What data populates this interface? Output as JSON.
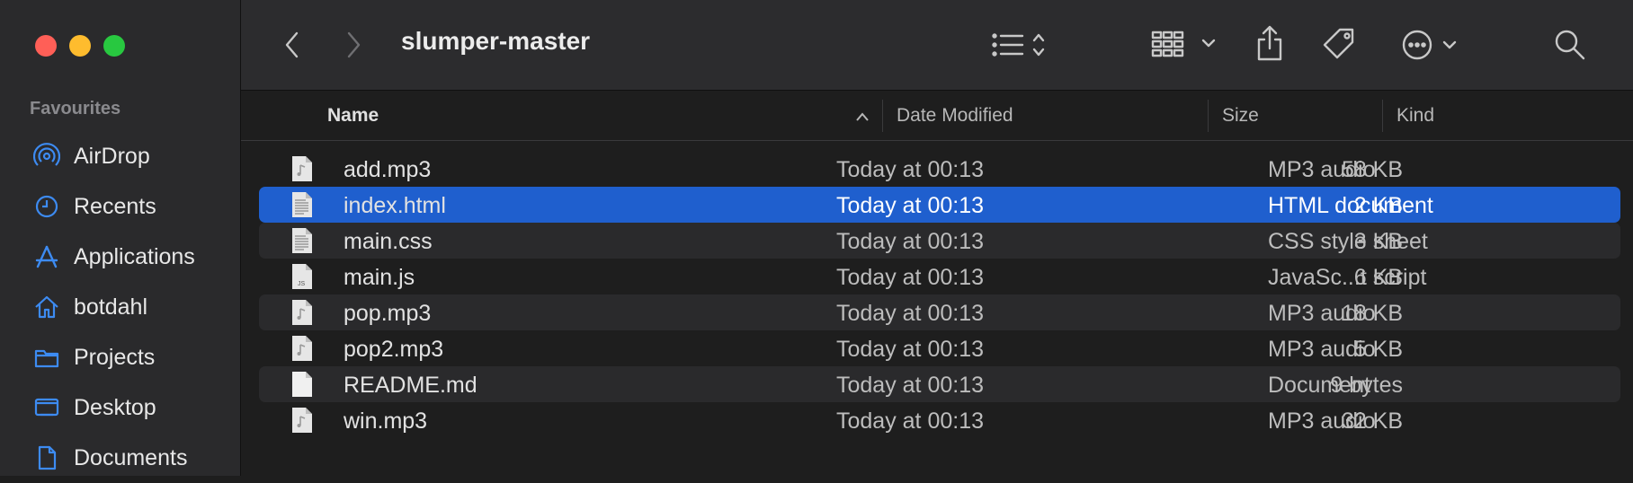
{
  "toolbar": {
    "title": "slumper-master",
    "icons": [
      "back-chevron",
      "forward-chevron",
      "list-view",
      "icon-grid",
      "share",
      "tag",
      "more",
      "search"
    ]
  },
  "sidebar": {
    "section": "Favourites",
    "items": [
      {
        "label": "AirDrop",
        "icon": "airdrop-icon"
      },
      {
        "label": "Recents",
        "icon": "clock-icon"
      },
      {
        "label": "Applications",
        "icon": "applications-icon"
      },
      {
        "label": "botdahl",
        "icon": "home-icon"
      },
      {
        "label": "Projects",
        "icon": "folder-icon"
      },
      {
        "label": "Desktop",
        "icon": "desktop-icon"
      },
      {
        "label": "Documents",
        "icon": "document-icon"
      }
    ]
  },
  "columns": {
    "name": "Name",
    "date": "Date Modified",
    "size": "Size",
    "kind": "Kind"
  },
  "files": [
    {
      "name": "add.mp3",
      "date": "Today at 00:13",
      "size": "58 KB",
      "kind": "MP3 audio",
      "type": "audio"
    },
    {
      "name": "index.html",
      "date": "Today at 00:13",
      "size": "2 KB",
      "kind": "HTML document",
      "type": "text",
      "selected": true
    },
    {
      "name": "main.css",
      "date": "Today at 00:13",
      "size": "3 KB",
      "kind": "CSS style sheet",
      "type": "text"
    },
    {
      "name": "main.js",
      "date": "Today at 00:13",
      "size": "6 KB",
      "kind": "JavaSc...t script",
      "type": "js"
    },
    {
      "name": "pop.mp3",
      "date": "Today at 00:13",
      "size": "18 KB",
      "kind": "MP3 audio",
      "type": "audio"
    },
    {
      "name": "pop2.mp3",
      "date": "Today at 00:13",
      "size": "5 KB",
      "kind": "MP3 audio",
      "type": "audio"
    },
    {
      "name": "README.md",
      "date": "Today at 00:13",
      "size": "9 bytes",
      "kind": "Document",
      "type": "blank"
    },
    {
      "name": "win.mp3",
      "date": "Today at 00:13",
      "size": "32 KB",
      "kind": "MP3 audio",
      "type": "audio"
    }
  ],
  "colors": {
    "accent": "#1f5fce",
    "sidebar_icon": "#3d8bf2"
  }
}
